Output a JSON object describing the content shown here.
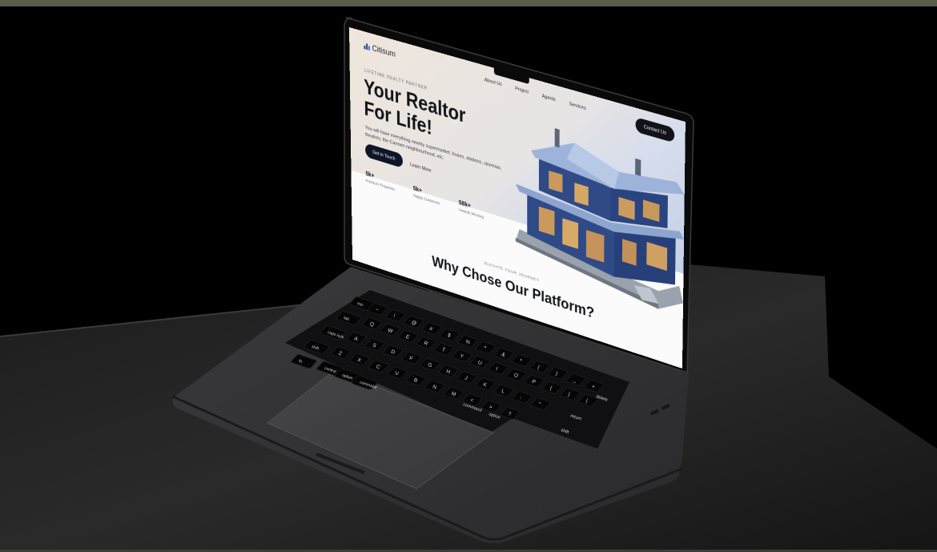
{
  "site": {
    "logo_text": "Citisum",
    "nav": [
      "About Us",
      "Project",
      "Agents",
      "Services"
    ],
    "contact_button": "Contact Us",
    "tagline": "LIFETIME REALTY PARTNER",
    "hero_line1": "Your Realtor",
    "hero_line2": "For Life!",
    "description": "You will have everything nearby supermarket, buses, stations, cinemas, theatres, the Carmen neighbourhood, etc.",
    "cta_button": "Get in Touch",
    "learn_more": "Learn More",
    "stats": [
      {
        "value": "5k+",
        "label": "Premium Properties"
      },
      {
        "value": "5k+",
        "label": "Happy Customers"
      },
      {
        "value": "58k+",
        "label": "Awards Winning"
      }
    ],
    "section_eyebrow": "ELEVATE YOUR JOURNEY",
    "section_title": "Why Chose Our Platform?"
  },
  "keyboard": {
    "row_esc": [
      "esc"
    ],
    "row_tab": [
      "tab"
    ],
    "row_caps": [
      "caps lock"
    ],
    "row_shift": [
      "shift"
    ],
    "row_bottom": [
      "fn",
      "control",
      "option",
      "command"
    ],
    "right_side": [
      "delete",
      "return",
      "shift",
      "option",
      "command"
    ],
    "letters_row1": [
      "Q",
      "W",
      "E",
      "R",
      "T",
      "Y",
      "U",
      "I",
      "O",
      "P",
      "{",
      "}",
      "|"
    ],
    "letters_row2": [
      "A",
      "S",
      "D",
      "F",
      "G",
      "H",
      "J",
      "K",
      "L",
      ":",
      "\""
    ],
    "letters_row3": [
      "Z",
      "X",
      "C",
      "V",
      "B",
      "N",
      "M",
      "<",
      ">",
      "?"
    ],
    "numbers_row": [
      "~",
      "!",
      "@",
      "#",
      "$",
      "%",
      "^",
      "&",
      "*",
      "(",
      ")",
      "_",
      "+"
    ]
  },
  "colors": {
    "background": "#000000",
    "laptop_body": "#2e2e30",
    "button_dark": "#0d1526",
    "house_blue": "#2f4a86"
  }
}
